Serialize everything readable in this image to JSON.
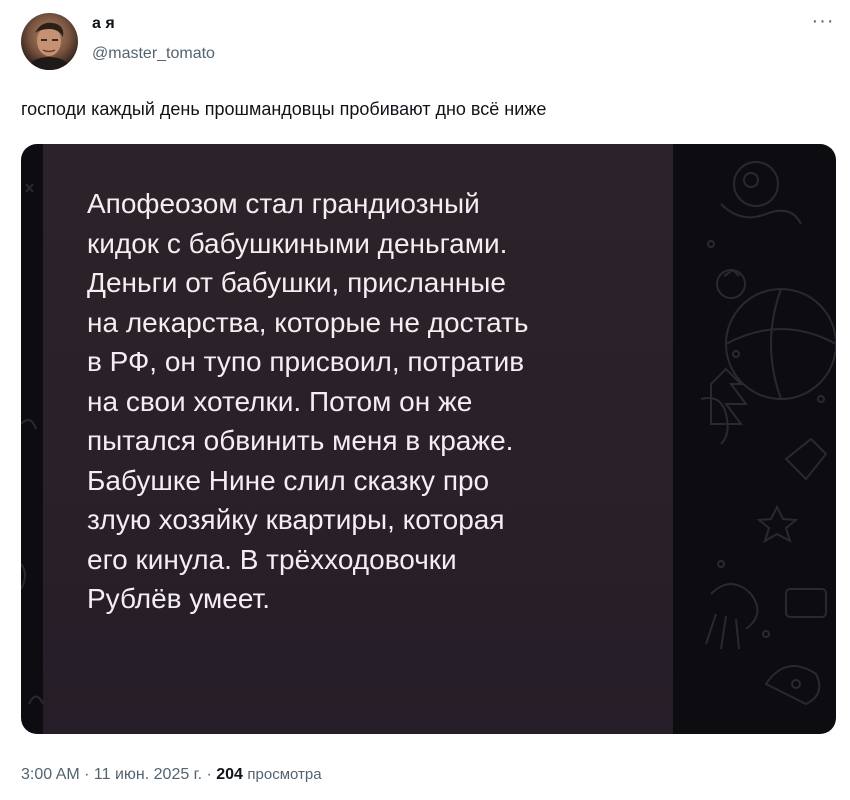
{
  "tweet": {
    "author": {
      "display_name": "а я",
      "handle": "@master_tomato",
      "avatar": "profile-photo"
    },
    "more_icon": "more-horizontal-icon",
    "more_label": "···",
    "text": "господи каждый день прошмандовцы пробивают дно всё ниже",
    "media": {
      "type": "screenshot",
      "message_text": "Апофеозом стал грандиозный\nкидок с бабушкиными деньгами.\nДеньги от бабушки, присланные\nна лекарства, которые не достать\nв РФ, он тупо присвоил, потратив\nна свои хотелки. Потом он же\nпытался обвинить меня в краже.\nБабушке Нине слил сказку про\nзлую хозяйку квартиры, которая\nего кинула. В трёхходовочки\nРублёв умеет.",
      "bubble_color": "#2a2029",
      "text_color": "#f2eef1"
    },
    "timestamp": "3:00 AM · 11 июн. 2025 г. · ",
    "views_count": "204",
    "views_label": "просмотра"
  }
}
